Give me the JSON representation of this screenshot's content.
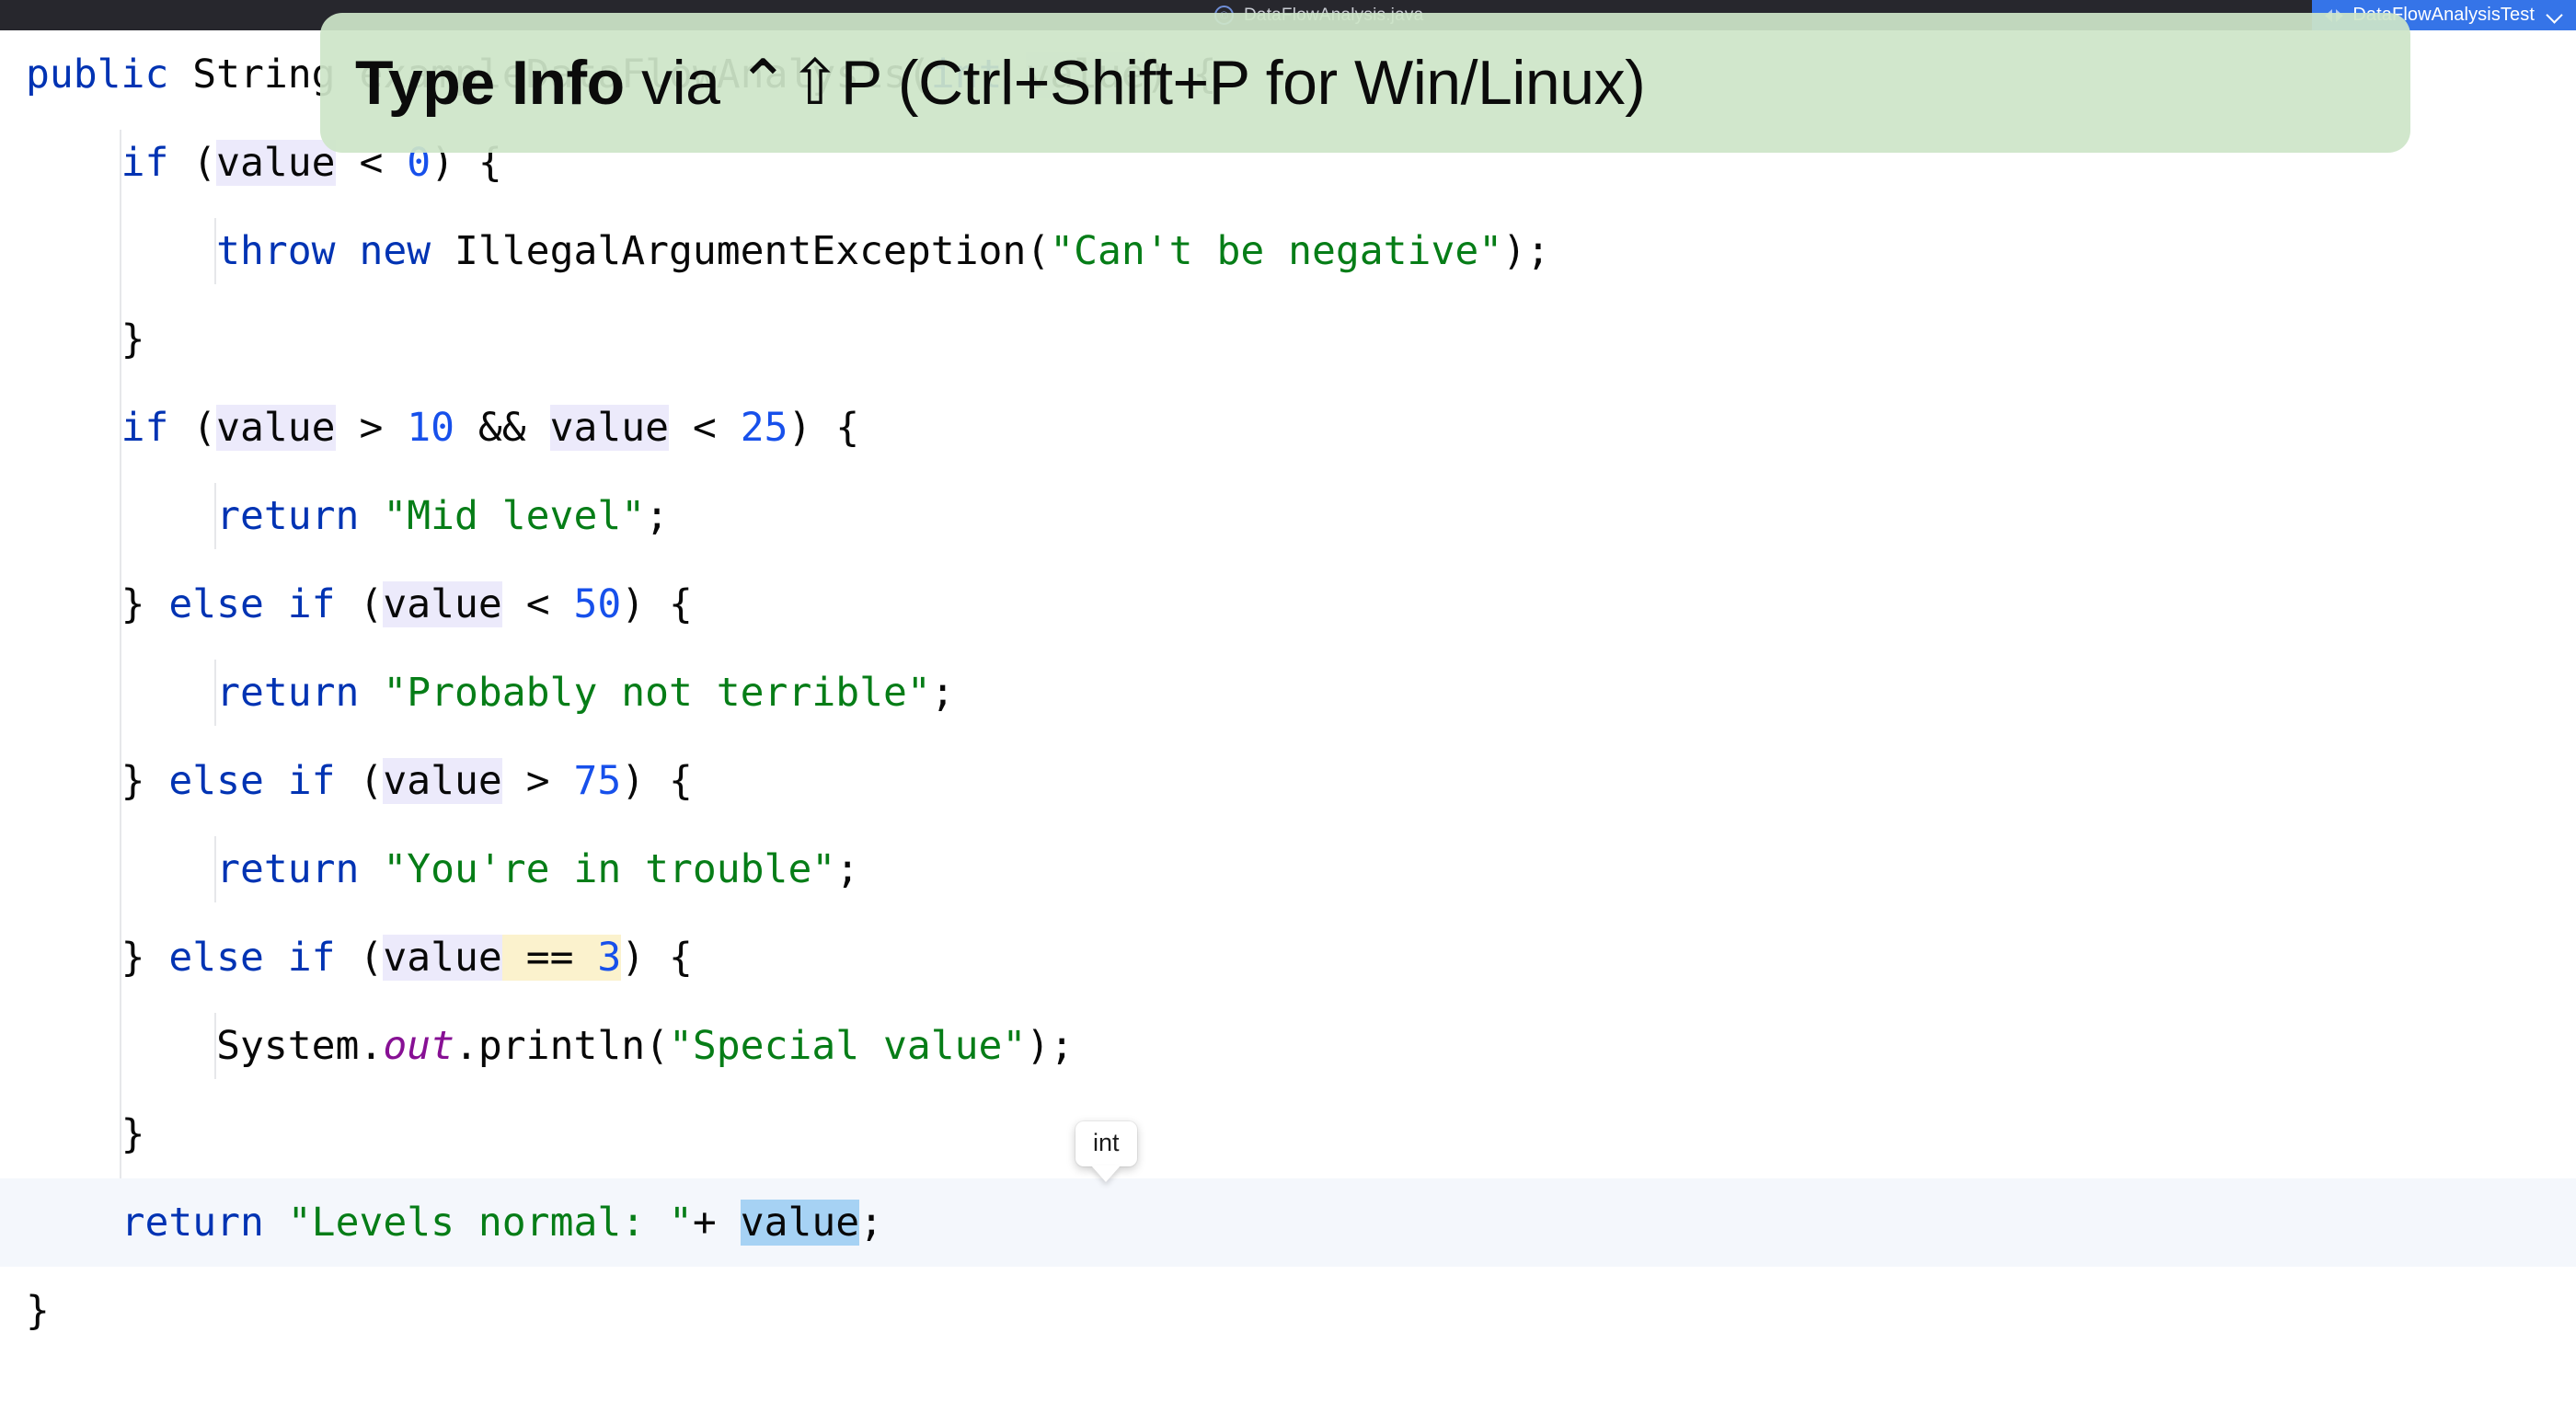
{
  "topbar": {
    "file_tab": {
      "icon": "java-class-icon",
      "glyph": "©",
      "label": "DataFlowAnalysis.java"
    },
    "run_config": {
      "icon": "run-config-icon",
      "label": "DataFlowAnalysisTest",
      "chevron": "chevron-down-icon"
    }
  },
  "banner": {
    "bold_text": "Type Info",
    "rest_text": " via ⌃⇧P (Ctrl+Shift+P for Win/Linux)",
    "background_color": "#cde5c8"
  },
  "tooltip": {
    "text": "int"
  },
  "colors": {
    "keyword": "#0033b3",
    "number": "#1750eb",
    "string": "#067d17",
    "static_field": "#871094",
    "plain": "#080808",
    "identifier_highlight": "#eceafb",
    "cream_highlight": "#fbf2cd",
    "selection": "#a6d2f4",
    "current_line": "#f4f7fc",
    "topbar_bg": "#27272d",
    "run_config_bg": "#3574e8"
  },
  "code": {
    "language": "java",
    "lines": [
      {
        "n": 1,
        "indent": 0,
        "current": false,
        "tokens": [
          {
            "t": "public",
            "c": "kw"
          },
          {
            "t": " ",
            "c": "plain"
          },
          {
            "t": "String",
            "c": "plain"
          },
          {
            "t": " ",
            "c": "plain"
          },
          {
            "t": "exampleDataFlowAnalysis",
            "c": "plain"
          },
          {
            "t": "(",
            "c": "plain"
          },
          {
            "t": "int",
            "c": "kw"
          },
          {
            "t": " ",
            "c": "plain"
          },
          {
            "t": "value",
            "c": "plain",
            "hl": "ident"
          },
          {
            "t": ") {",
            "c": "plain"
          }
        ]
      },
      {
        "n": 2,
        "indent": 1,
        "current": false,
        "tokens": [
          {
            "t": "if",
            "c": "kw"
          },
          {
            "t": " (",
            "c": "plain"
          },
          {
            "t": "value",
            "c": "plain",
            "hl": "ident"
          },
          {
            "t": " < ",
            "c": "plain"
          },
          {
            "t": "0",
            "c": "num"
          },
          {
            "t": ") {",
            "c": "plain"
          }
        ]
      },
      {
        "n": 3,
        "indent": 2,
        "current": false,
        "tokens": [
          {
            "t": "throw",
            "c": "kw"
          },
          {
            "t": " ",
            "c": "plain"
          },
          {
            "t": "new",
            "c": "kw"
          },
          {
            "t": " ",
            "c": "plain"
          },
          {
            "t": "IllegalArgumentException",
            "c": "plain"
          },
          {
            "t": "(",
            "c": "plain"
          },
          {
            "t": "\"Can't be negative\"",
            "c": "str"
          },
          {
            "t": ");",
            "c": "plain"
          }
        ]
      },
      {
        "n": 4,
        "indent": 1,
        "current": false,
        "tokens": [
          {
            "t": "}",
            "c": "plain"
          }
        ]
      },
      {
        "n": 5,
        "indent": 1,
        "current": false,
        "tokens": [
          {
            "t": "if",
            "c": "kw"
          },
          {
            "t": " (",
            "c": "plain"
          },
          {
            "t": "value",
            "c": "plain",
            "hl": "ident"
          },
          {
            "t": " > ",
            "c": "plain"
          },
          {
            "t": "10",
            "c": "num"
          },
          {
            "t": " && ",
            "c": "plain"
          },
          {
            "t": "value",
            "c": "plain",
            "hl": "ident"
          },
          {
            "t": " < ",
            "c": "plain"
          },
          {
            "t": "25",
            "c": "num"
          },
          {
            "t": ") {",
            "c": "plain"
          }
        ]
      },
      {
        "n": 6,
        "indent": 2,
        "current": false,
        "tokens": [
          {
            "t": "return",
            "c": "kw"
          },
          {
            "t": " ",
            "c": "plain"
          },
          {
            "t": "\"Mid level\"",
            "c": "str"
          },
          {
            "t": ";",
            "c": "plain"
          }
        ]
      },
      {
        "n": 7,
        "indent": 1,
        "current": false,
        "tokens": [
          {
            "t": "} ",
            "c": "plain"
          },
          {
            "t": "else",
            "c": "kw"
          },
          {
            "t": " ",
            "c": "plain"
          },
          {
            "t": "if",
            "c": "kw"
          },
          {
            "t": " (",
            "c": "plain"
          },
          {
            "t": "value",
            "c": "plain",
            "hl": "ident"
          },
          {
            "t": " < ",
            "c": "plain"
          },
          {
            "t": "50",
            "c": "num"
          },
          {
            "t": ") {",
            "c": "plain"
          }
        ]
      },
      {
        "n": 8,
        "indent": 2,
        "current": false,
        "tokens": [
          {
            "t": "return",
            "c": "kw"
          },
          {
            "t": " ",
            "c": "plain"
          },
          {
            "t": "\"Probably not terrible\"",
            "c": "str"
          },
          {
            "t": ";",
            "c": "plain"
          }
        ]
      },
      {
        "n": 9,
        "indent": 1,
        "current": false,
        "tokens": [
          {
            "t": "} ",
            "c": "plain"
          },
          {
            "t": "else",
            "c": "kw"
          },
          {
            "t": " ",
            "c": "plain"
          },
          {
            "t": "if",
            "c": "kw"
          },
          {
            "t": " (",
            "c": "plain"
          },
          {
            "t": "value",
            "c": "plain",
            "hl": "ident"
          },
          {
            "t": " > ",
            "c": "plain"
          },
          {
            "t": "75",
            "c": "num"
          },
          {
            "t": ") {",
            "c": "plain"
          }
        ]
      },
      {
        "n": 10,
        "indent": 2,
        "current": false,
        "tokens": [
          {
            "t": "return",
            "c": "kw"
          },
          {
            "t": " ",
            "c": "plain"
          },
          {
            "t": "\"You're in trouble\"",
            "c": "str"
          },
          {
            "t": ";",
            "c": "plain"
          }
        ]
      },
      {
        "n": 11,
        "indent": 1,
        "current": false,
        "tokens": [
          {
            "t": "} ",
            "c": "plain"
          },
          {
            "t": "else",
            "c": "kw"
          },
          {
            "t": " ",
            "c": "plain"
          },
          {
            "t": "if",
            "c": "kw"
          },
          {
            "t": " (",
            "c": "plain"
          },
          {
            "t": "value",
            "c": "plain",
            "hl": "ident"
          },
          {
            "t": " == ",
            "c": "plain",
            "hl": "cream"
          },
          {
            "t": "3",
            "c": "num",
            "hl": "cream"
          },
          {
            "t": ") {",
            "c": "plain"
          }
        ]
      },
      {
        "n": 12,
        "indent": 2,
        "current": false,
        "tokens": [
          {
            "t": "System",
            "c": "plain"
          },
          {
            "t": ".",
            "c": "plain"
          },
          {
            "t": "out",
            "c": "stat"
          },
          {
            "t": ".println(",
            "c": "plain"
          },
          {
            "t": "\"Special value\"",
            "c": "str"
          },
          {
            "t": ");",
            "c": "plain"
          }
        ]
      },
      {
        "n": 13,
        "indent": 1,
        "current": false,
        "tokens": [
          {
            "t": "}",
            "c": "plain"
          }
        ]
      },
      {
        "n": 14,
        "indent": 1,
        "current": true,
        "tokens": [
          {
            "t": "return",
            "c": "kw"
          },
          {
            "t": " ",
            "c": "plain"
          },
          {
            "t": "\"Levels normal: \"",
            "c": "str"
          },
          {
            "t": "+ ",
            "c": "plain"
          },
          {
            "t": "value",
            "c": "plain",
            "hl": "sel"
          },
          {
            "t": ";",
            "c": "plain"
          }
        ]
      },
      {
        "n": 15,
        "indent": 0,
        "current": false,
        "tokens": [
          {
            "t": "}",
            "c": "plain"
          }
        ]
      }
    ]
  }
}
